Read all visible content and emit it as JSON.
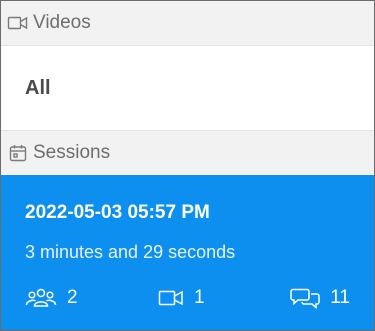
{
  "videos_section": {
    "title": "Videos",
    "icon": "video-camera-icon",
    "all_label": "All"
  },
  "sessions_section": {
    "title": "Sessions",
    "icon": "calendar-icon"
  },
  "sessions": [
    {
      "date": "2022-05-03 05:57 PM",
      "duration": "3 minutes and 29 seconds",
      "participants": "2",
      "videos": "1",
      "messages": "11",
      "selected": true
    }
  ],
  "colors": {
    "selected_background": "#0d8fef",
    "header_background": "#f2f2f2",
    "header_text": "#6e6e6e",
    "item_text": "#4a4a4a"
  }
}
